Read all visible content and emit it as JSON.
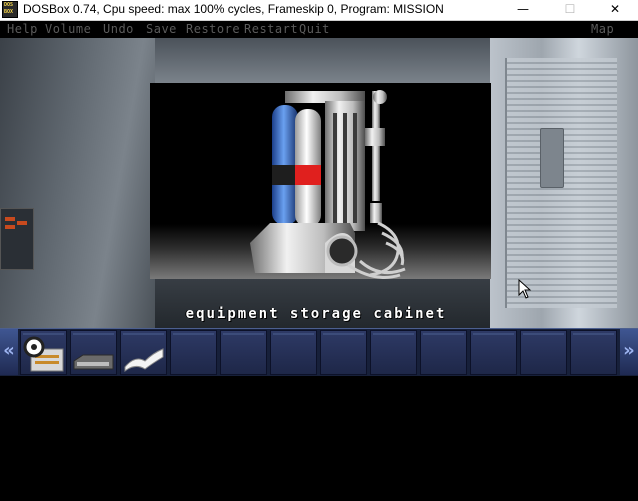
{
  "window": {
    "title": "DOSBox 0.74, Cpu speed: max 100% cycles, Frameskip  0, Program:  MISSION",
    "icon": "dosbox-app-icon",
    "icon_text_top": "DOS",
    "icon_text_bottom": "BOX",
    "controls": {
      "minimize": "—",
      "maximize": "☐",
      "close": "✕"
    }
  },
  "menu": {
    "items": [
      "Help",
      "Volume",
      "Undo",
      "Save",
      "Restore",
      "Restart",
      "Quit"
    ],
    "right_item": "Map"
  },
  "scene": {
    "caption": "equipment storage cabinet"
  },
  "inventory": {
    "left_arrow": "«",
    "right_arrow": "»",
    "items": [
      "data-disc-item",
      "device-item",
      "paper-item",
      "",
      "",
      "",
      "",
      "",
      "",
      "",
      "",
      ""
    ]
  },
  "colors": {
    "inventory_bg": "#17203a",
    "menu_text": "#5b5b5b",
    "cabinet_red": "#e0201e",
    "cabinet_blue": "#3b78d8"
  }
}
